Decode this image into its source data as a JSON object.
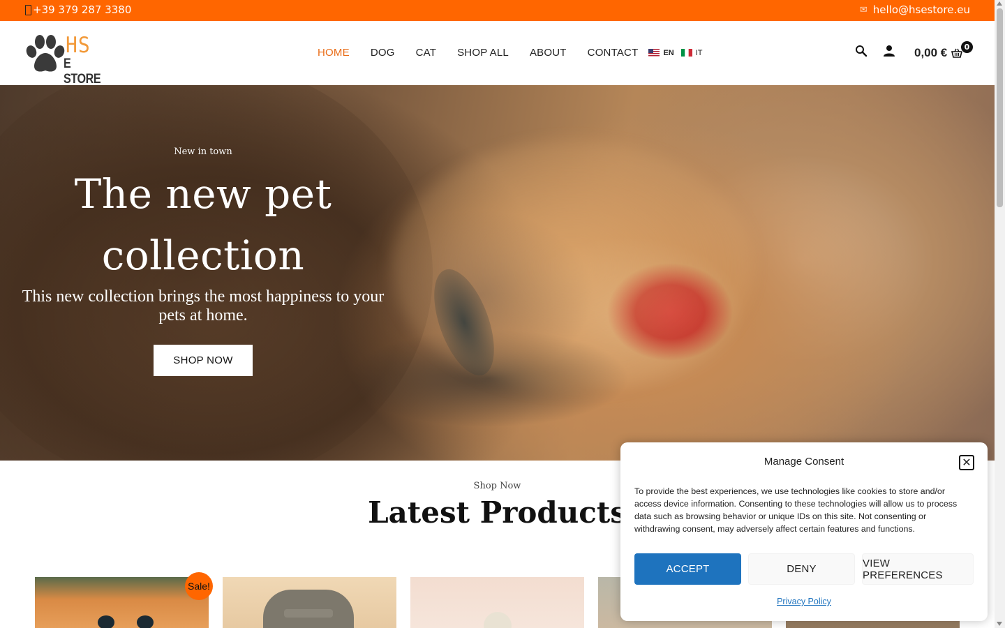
{
  "topbar": {
    "phone": "+39 379 287 3380",
    "email": "hello@hsestore.eu",
    "background": "#ff6600"
  },
  "logo": {
    "line1": "HS",
    "line2": "E STORE",
    "icon": "paw-icon"
  },
  "nav": {
    "items": [
      "HOME",
      "DOG",
      "CAT",
      "SHOP ALL",
      "ABOUT",
      "CONTACT"
    ],
    "active": "HOME",
    "active_color": "#e96b15",
    "languages": [
      {
        "code": "EN",
        "flag": "us-flag-icon"
      },
      {
        "code": "IT",
        "flag": "it-flag-icon"
      }
    ]
  },
  "header_icons": {
    "search": "search-icon",
    "account": "user-icon",
    "cart": "basket-icon",
    "cart_total": "0,00 €",
    "cart_count": "0"
  },
  "hero": {
    "pretitle": "New in town",
    "title_line1": "The new pet",
    "title_line2": "collection",
    "subtitle": "This new collection brings the most happiness to your pets at home.",
    "button": "SHOP NOW"
  },
  "products_section": {
    "pretitle": "Shop Now",
    "title": "Latest Products",
    "sale_badge": "Sale!"
  },
  "consent": {
    "title": "Manage Consent",
    "text": "To provide the best experiences, we use technologies like cookies to store and/or access device information. Consenting to these technologies will allow us to process data such as browsing behavior or unique IDs on this site. Not consenting or withdrawing consent, may adversely affect certain features and functions.",
    "accept": "ACCEPT",
    "deny": "DENY",
    "preferences": "VIEW PREFERENCES",
    "privacy_link": "Privacy Policy",
    "accept_color": "#1e73be"
  }
}
